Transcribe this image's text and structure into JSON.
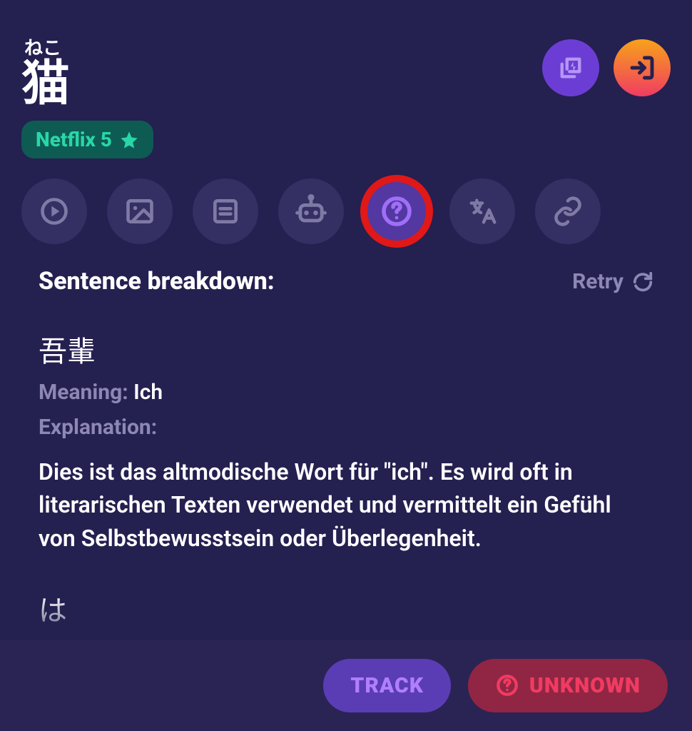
{
  "word": {
    "furigana": "ねこ",
    "kanji": "猫"
  },
  "badge": {
    "label": "Netflix 5"
  },
  "breakdown": {
    "title": "Sentence breakdown:",
    "retry": "Retry",
    "entries": [
      {
        "jp": "吾輩",
        "meaning_label": "Meaning:",
        "meaning": "Ich",
        "explanation_label": "Explanation:",
        "explanation": "Dies ist das altmodische Wort für \"ich\". Es wird oft in literarischen Texten verwendet und vermittelt ein Gefühl von Selbstbewusstsein oder Überlegenheit."
      },
      {
        "jp": "は"
      }
    ]
  },
  "footer": {
    "track": "TRACK",
    "unknown": "UNKNOWN"
  }
}
